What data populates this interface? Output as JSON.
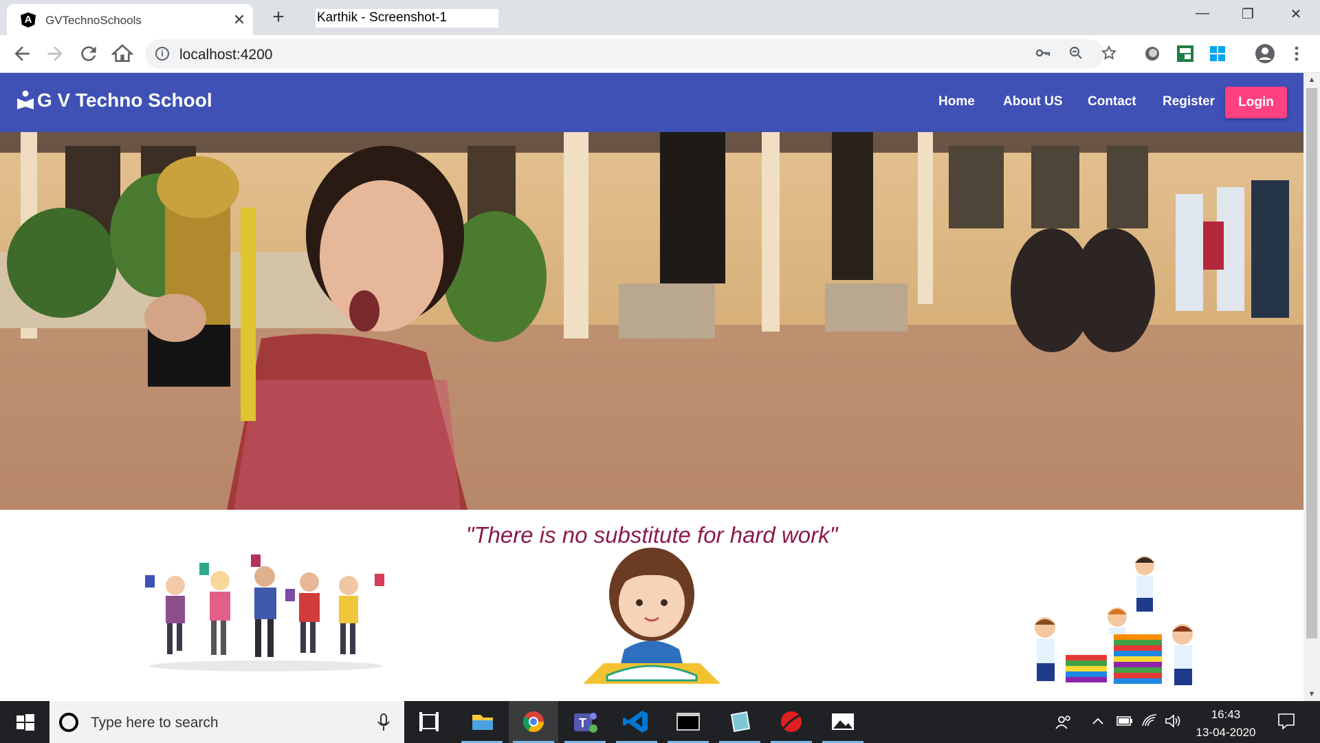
{
  "browser": {
    "tab_title": "GVTechnoSchools",
    "tab_close": "✕",
    "new_tab": "+",
    "overlay_label": "Karthik - Screenshot-1",
    "url": "localhost:4200",
    "window_minimize": "—",
    "window_restore": "❐",
    "window_close": "✕"
  },
  "navbar": {
    "brand": "G V Techno School",
    "links": [
      "Home",
      "About US",
      "Contact",
      "Register"
    ],
    "login": "Login",
    "color": "#3f51b5",
    "login_color": "#ff4081"
  },
  "hero": {
    "quote": "\"There is no substitute for hard work\""
  },
  "taskbar": {
    "search_placeholder": "Type here to search",
    "time": "16:43",
    "date": "13-04-2020"
  }
}
